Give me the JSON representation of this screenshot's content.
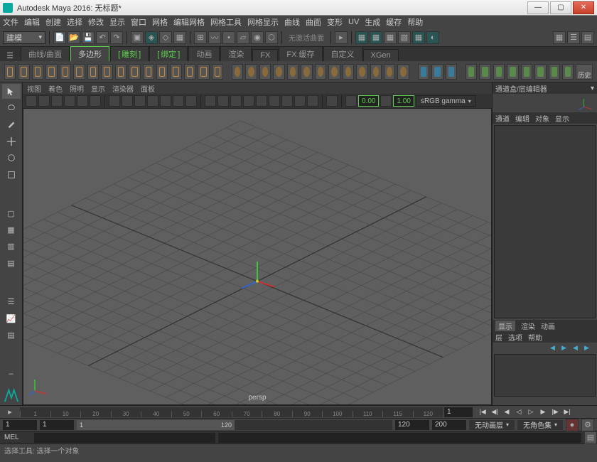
{
  "window": {
    "title": "Autodesk Maya 2016: 无标题*"
  },
  "menubar": [
    "文件",
    "编辑",
    "创建",
    "选择",
    "修改",
    "显示",
    "窗口",
    "网格",
    "编辑网格",
    "网格工具",
    "网格显示",
    "曲线",
    "曲面",
    "变形",
    "UV",
    "生成",
    "缓存",
    "帮助"
  ],
  "mode_select": "建模",
  "shelf_tabs": [
    {
      "label": "曲线/曲面"
    },
    {
      "label": "多边形",
      "active": true
    },
    {
      "label": "雕刻",
      "brac": true
    },
    {
      "label": "绑定",
      "brac": true
    },
    {
      "label": "动画"
    },
    {
      "label": "渲染"
    },
    {
      "label": "FX"
    },
    {
      "label": "FX 缓存"
    },
    {
      "label": "自定义"
    },
    {
      "label": "XGen"
    }
  ],
  "viewport_menu": [
    "视图",
    "着色",
    "照明",
    "显示",
    "渲染器",
    "面板"
  ],
  "viewport_toolbar": {
    "near": "0.00",
    "far": "1.00",
    "gamma": "sRGB gamma"
  },
  "viewport": {
    "camera": "persp"
  },
  "right_panel": {
    "title": "通道盒/层编辑器",
    "tabs1": [
      "通道",
      "编辑",
      "对象",
      "显示"
    ],
    "tabs2": [
      "显示",
      "渲染",
      "动画"
    ],
    "tabs3": [
      "层",
      "选项",
      "帮助"
    ]
  },
  "timeline": {
    "ticks": [
      1,
      10,
      20,
      30,
      40,
      50,
      60,
      70,
      80,
      90,
      100,
      110,
      115,
      120
    ],
    "current": "1"
  },
  "range": {
    "start_outer": "1",
    "start_inner": "1",
    "end_inner": "120",
    "end_outer": "200",
    "slider_end": "120",
    "anim_layer": "无动画层",
    "char_set": "无角色集"
  },
  "mel": {
    "label": "MEL"
  },
  "status": "选择工具: 选择一个对象",
  "history_label": "历史"
}
